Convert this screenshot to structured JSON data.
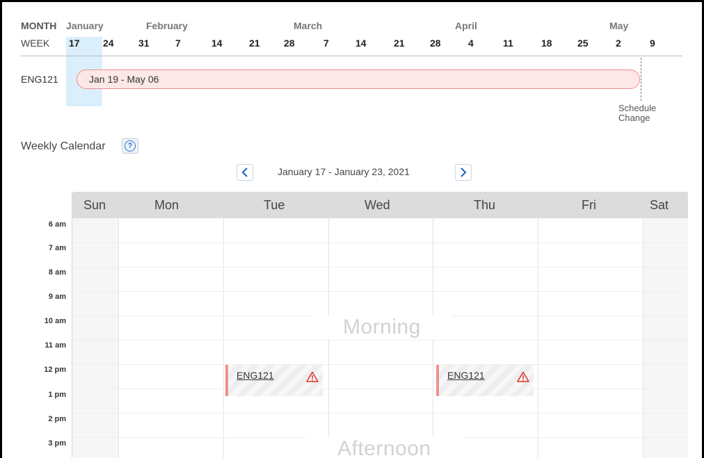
{
  "timeline": {
    "month_label": "MONTH",
    "months": [
      "January",
      "February",
      "March",
      "April",
      "May"
    ],
    "week_label": "WEEK",
    "weeks": [
      "17",
      "24",
      "31",
      "7",
      "14",
      "21",
      "28",
      "7",
      "14",
      "21",
      "28",
      "4",
      "11",
      "18",
      "25",
      "2",
      "9"
    ],
    "course": "ENG121",
    "course_range": "Jan 19 - May 06",
    "schedule_change_line1": "Schedule",
    "schedule_change_line2": "Change"
  },
  "weekly": {
    "title": "Weekly Calendar",
    "help_icon": "question-circle-icon",
    "range": "January 17 - January 23, 2021",
    "prev_icon": "chevron-left-icon",
    "next_icon": "chevron-right-icon",
    "days": [
      "Sun",
      "Mon",
      "Tue",
      "Wed",
      "Thu",
      "Fri",
      "Sat"
    ],
    "times": [
      "6 am",
      "7 am",
      "8 am",
      "9 am",
      "10 am",
      "11 am",
      "12 pm",
      "1 pm",
      "2 pm",
      "3 pm"
    ],
    "periods": [
      "Morning",
      "Afternoon"
    ],
    "events": [
      {
        "day": "Tue",
        "label": "ENG121",
        "icon": "warning-icon"
      },
      {
        "day": "Thu",
        "label": "ENG121",
        "icon": "warning-icon"
      }
    ]
  },
  "colors": {
    "course_bar_fill": "#fde8e8",
    "course_bar_border": "#f08a8a",
    "week_highlight": "#dbeefb",
    "accent": "#1f5fbf",
    "warning": "#d93025"
  }
}
